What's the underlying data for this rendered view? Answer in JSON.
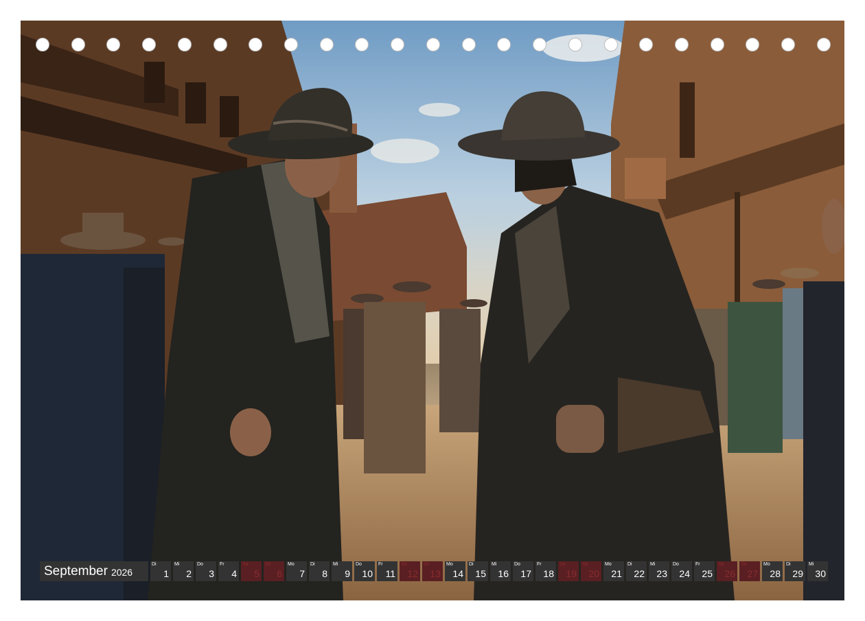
{
  "photo": {
    "subject": "two-cowboys-facing-off"
  },
  "calendar": {
    "month": "September",
    "year": "2026",
    "weekend_color": "#5a1f22",
    "weekday_color": "#333333",
    "days": [
      {
        "n": "1",
        "d": "Di",
        "we": false
      },
      {
        "n": "2",
        "d": "Mi",
        "we": false
      },
      {
        "n": "3",
        "d": "Do",
        "we": false
      },
      {
        "n": "4",
        "d": "Fr",
        "we": false
      },
      {
        "n": "5",
        "d": "Sa",
        "we": true
      },
      {
        "n": "6",
        "d": "So",
        "we": true
      },
      {
        "n": "7",
        "d": "Mo",
        "we": false
      },
      {
        "n": "8",
        "d": "Di",
        "we": false
      },
      {
        "n": "9",
        "d": "Mi",
        "we": false
      },
      {
        "n": "10",
        "d": "Do",
        "we": false
      },
      {
        "n": "11",
        "d": "Fr",
        "we": false
      },
      {
        "n": "12",
        "d": "Sa",
        "we": true
      },
      {
        "n": "13",
        "d": "So",
        "we": true
      },
      {
        "n": "14",
        "d": "Mo",
        "we": false
      },
      {
        "n": "15",
        "d": "Di",
        "we": false
      },
      {
        "n": "16",
        "d": "Mi",
        "we": false
      },
      {
        "n": "17",
        "d": "Do",
        "we": false
      },
      {
        "n": "18",
        "d": "Fr",
        "we": false
      },
      {
        "n": "19",
        "d": "Sa",
        "we": true
      },
      {
        "n": "20",
        "d": "So",
        "we": true
      },
      {
        "n": "21",
        "d": "Mo",
        "we": false
      },
      {
        "n": "22",
        "d": "Di",
        "we": false
      },
      {
        "n": "23",
        "d": "Mi",
        "we": false
      },
      {
        "n": "24",
        "d": "Do",
        "we": false
      },
      {
        "n": "25",
        "d": "Fr",
        "we": false
      },
      {
        "n": "26",
        "d": "Sa",
        "we": true
      },
      {
        "n": "27",
        "d": "So",
        "we": true
      },
      {
        "n": "28",
        "d": "Mo",
        "we": false
      },
      {
        "n": "29",
        "d": "Di",
        "we": false
      },
      {
        "n": "30",
        "d": "Mi",
        "we": false
      }
    ]
  }
}
